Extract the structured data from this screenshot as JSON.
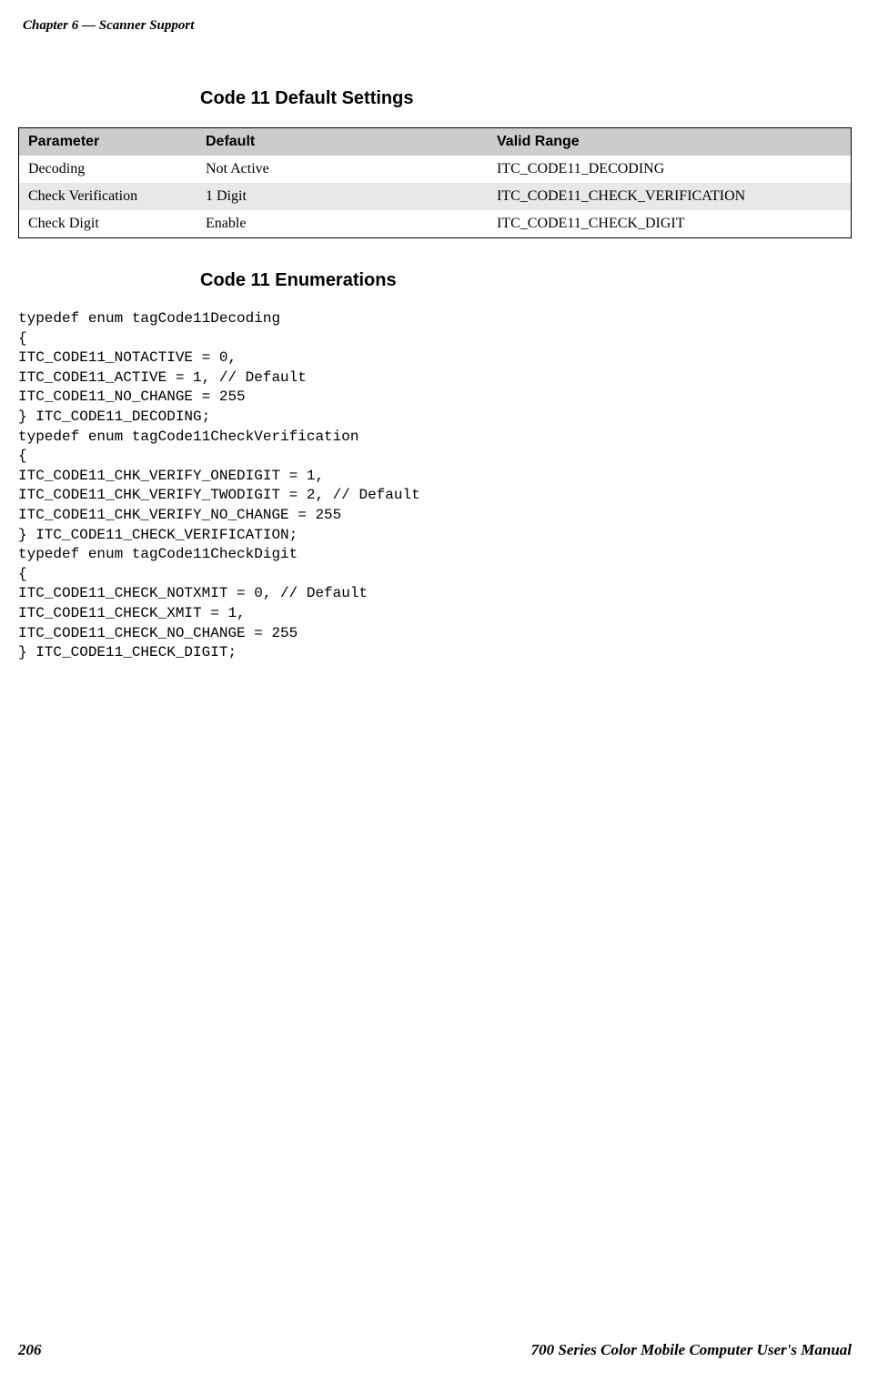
{
  "header": "Chapter 6  —  Scanner Support",
  "section1_title": "Code 11 Default Settings",
  "table": {
    "headers": [
      "Parameter",
      "Default",
      "Valid Range"
    ],
    "rows": [
      {
        "c1": "Decoding",
        "c2": "Not Active",
        "c3": "ITC_CODE11_DECODING"
      },
      {
        "c1": "Check Verification",
        "c2": "1 Digit",
        "c3": "ITC_CODE11_CHECK_VERIFICATION"
      },
      {
        "c1": "Check Digit",
        "c2": "Enable",
        "c3": "ITC_CODE11_CHECK_DIGIT"
      }
    ]
  },
  "section2_title": "Code 11 Enumerations",
  "code_block": "typedef enum tagCode11Decoding\n{\nITC_CODE11_NOTACTIVE = 0,\nITC_CODE11_ACTIVE = 1, // Default\nITC_CODE11_NO_CHANGE = 255\n} ITC_CODE11_DECODING;\ntypedef enum tagCode11CheckVerification\n{\nITC_CODE11_CHK_VERIFY_ONEDIGIT = 1,\nITC_CODE11_CHK_VERIFY_TWODIGIT = 2, // Default\nITC_CODE11_CHK_VERIFY_NO_CHANGE = 255\n} ITC_CODE11_CHECK_VERIFICATION;\ntypedef enum tagCode11CheckDigit\n{\nITC_CODE11_CHECK_NOTXMIT = 0, // Default\nITC_CODE11_CHECK_XMIT = 1,\nITC_CODE11_CHECK_NO_CHANGE = 255\n} ITC_CODE11_CHECK_DIGIT;",
  "footer": {
    "page_number": "206",
    "title": "700 Series Color Mobile Computer User's Manual"
  }
}
